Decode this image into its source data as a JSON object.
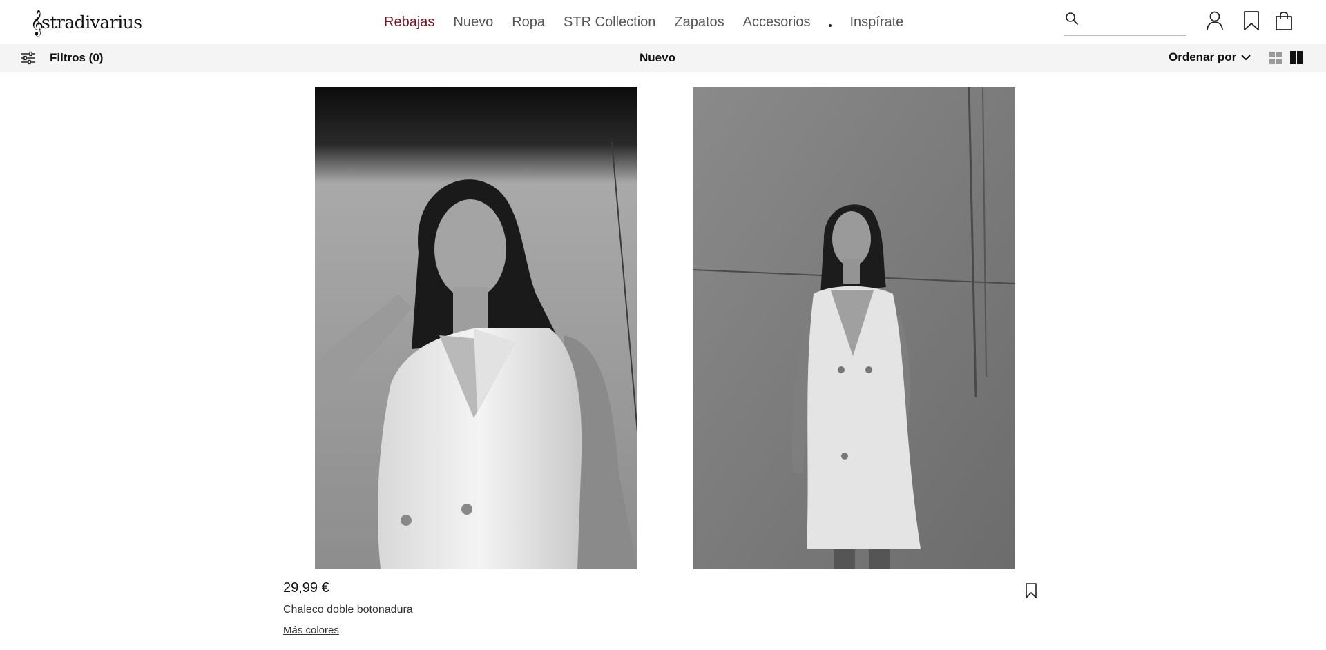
{
  "brand": {
    "name": "stradivarius",
    "logo_icon": "treble-clef-icon"
  },
  "nav": {
    "items": [
      {
        "label": "Rebajas",
        "active": true
      },
      {
        "label": "Nuevo",
        "active": false
      },
      {
        "label": "Ropa",
        "active": false
      },
      {
        "label": "STR Collection",
        "active": false
      },
      {
        "label": "Zapatos",
        "active": false
      },
      {
        "label": "Accesorios",
        "active": false
      },
      {
        "label": "Inspírate",
        "active": false
      }
    ],
    "separator_icon": "dot-icon"
  },
  "search": {
    "icon": "search-icon",
    "value": "",
    "placeholder": ""
  },
  "header_icons": [
    "user-icon",
    "bookmark-icon",
    "shopping-bag-icon"
  ],
  "filter_bar": {
    "filters_label": "Filtros (0)",
    "filters_icon": "sliders-icon",
    "title": "Nuevo",
    "sort_label": "Ordenar por",
    "sort_icon": "chevron-down-icon",
    "view_icons": [
      "grid-small-icon",
      "grid-large-icon"
    ],
    "active_view": "grid-large-icon"
  },
  "product": {
    "price": "29,99 €",
    "name": "Chaleco doble botonadura",
    "more_colors": "Más colores",
    "wishlist_icon": "bookmark-icon"
  },
  "colors": {
    "accent": "#7a1424",
    "nav_text": "#555555",
    "bar_bg": "#f4f4f4"
  }
}
